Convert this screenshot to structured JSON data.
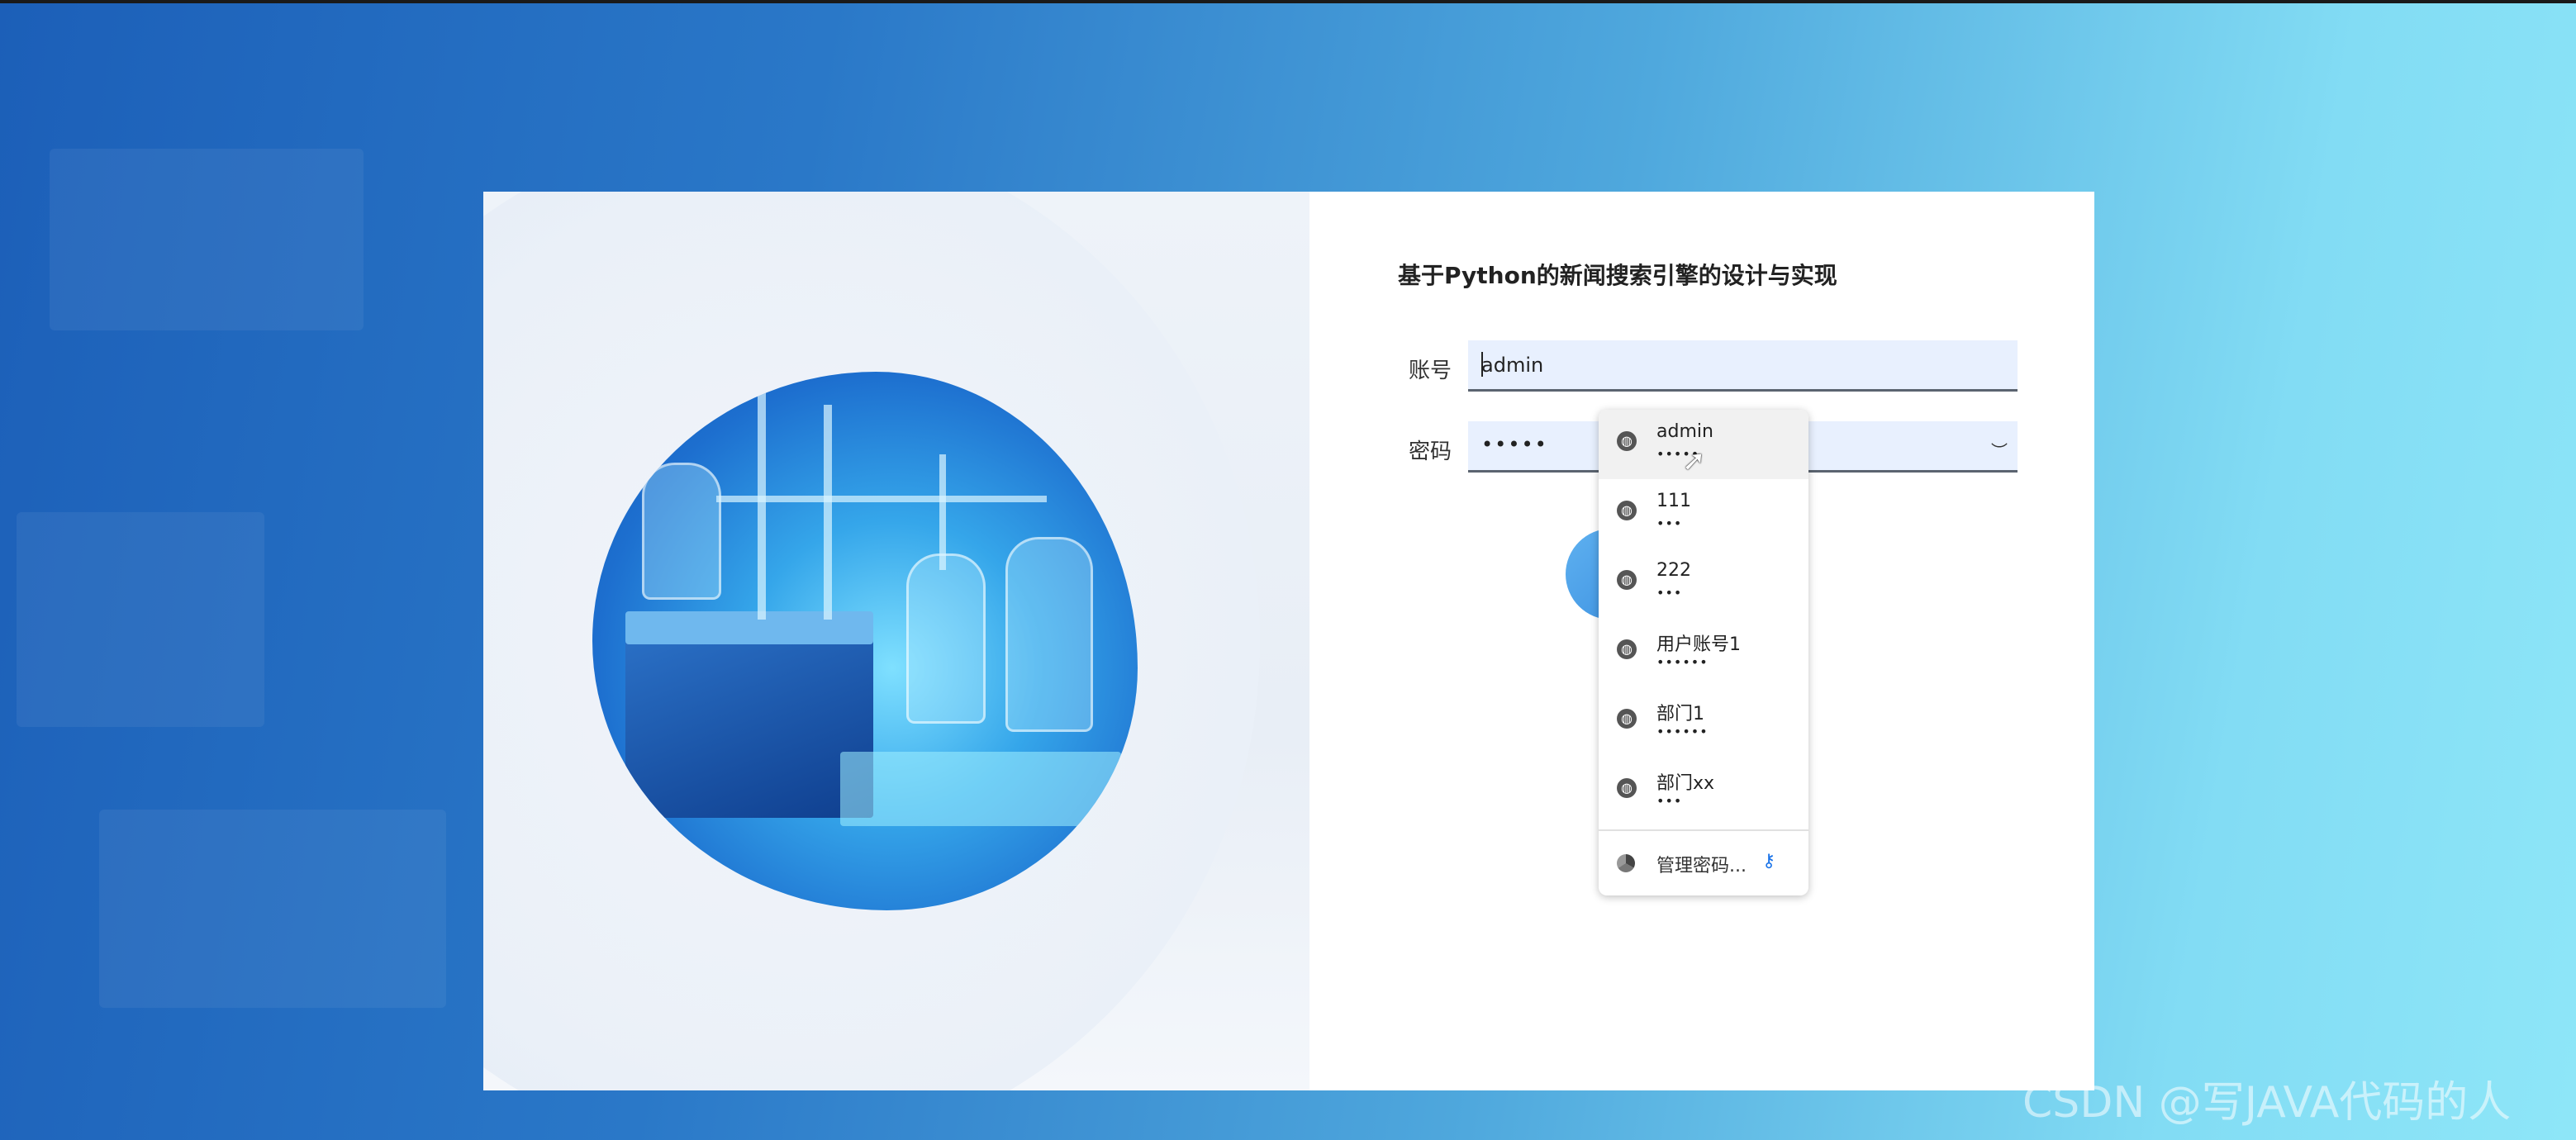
{
  "form": {
    "title": "基于Python的新闻搜索引擎的设计与实现",
    "account_label": "账号",
    "account_value": "admin",
    "password_label": "密码",
    "password_value": "•••••"
  },
  "autofill": {
    "items": [
      {
        "username": "admin",
        "password_mask": "•••••"
      },
      {
        "username": "111",
        "password_mask": "•••"
      },
      {
        "username": "222",
        "password_mask": "•••"
      },
      {
        "username": "用户账号1",
        "password_mask": "••••••"
      },
      {
        "username": "部门1",
        "password_mask": "••••••"
      },
      {
        "username": "部门xx",
        "password_mask": "•••"
      }
    ],
    "manage_label": "管理密码..."
  },
  "watermark": "CSDN @写JAVA代码的人",
  "colors": {
    "field_bg": "#e8f0fe",
    "accent_blue": "#3a8fe0"
  },
  "icons": {
    "eye": "eye-closed-icon",
    "globe": "globe-icon",
    "chrome": "chrome-icon",
    "key": "key-icon"
  }
}
